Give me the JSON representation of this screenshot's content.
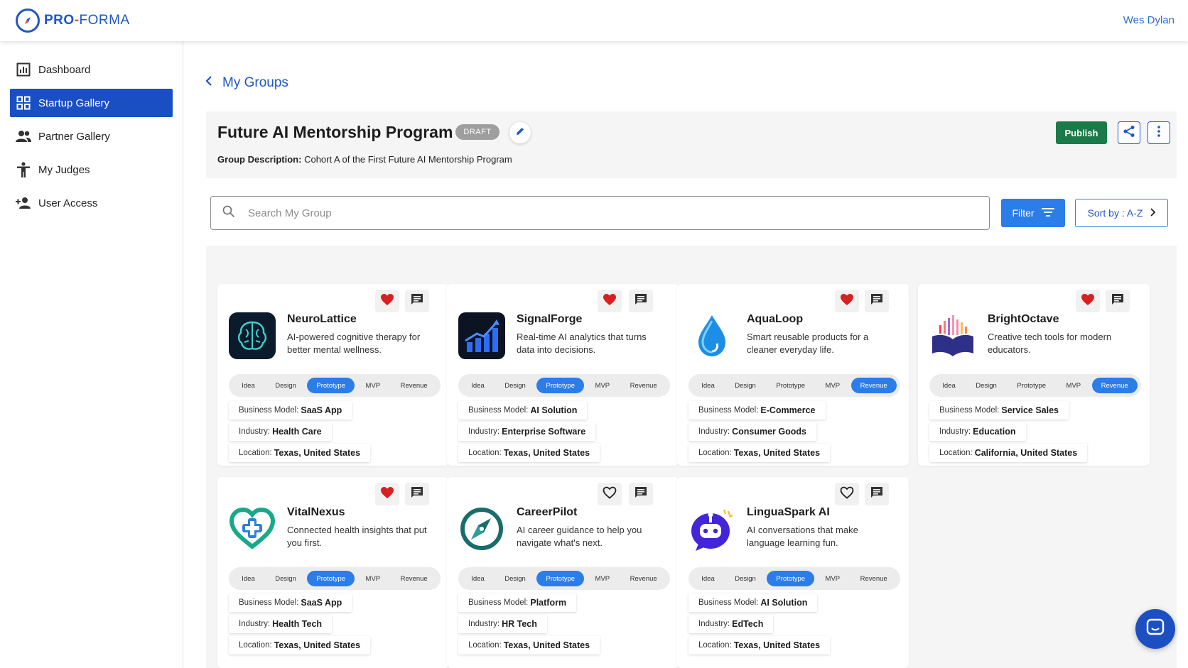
{
  "app": {
    "logo_text_left": "PRO",
    "logo_text_dash": "-",
    "logo_text_right": "FORMA",
    "user_name": "Wes Dylan",
    "brand_color": "#1f56c9"
  },
  "sidebar": {
    "items": [
      {
        "label": "Dashboard",
        "icon": "chart-icon"
      },
      {
        "label": "Startup Gallery",
        "icon": "grid-icon",
        "active": true
      },
      {
        "label": "Partner Gallery",
        "icon": "people-icon"
      },
      {
        "label": "My Judges",
        "icon": "person-icon"
      },
      {
        "label": "User Access",
        "icon": "add-user-icon"
      }
    ]
  },
  "breadcrumb": {
    "back_label": "My Groups"
  },
  "group": {
    "title": "Future AI Mentorship Program",
    "status": "DRAFT",
    "description_label": "Group Description:",
    "description": "Cohort A of the First Future AI Mentorship Program",
    "publish_label": "Publish"
  },
  "search": {
    "placeholder": "Search My Group",
    "value": ""
  },
  "filter_label": "Filter",
  "sort_label": "Sort by : A-Z",
  "labels": {
    "business_model": "Business Model:",
    "industry": "Industry:",
    "location": "Location:"
  },
  "stages": [
    "Idea",
    "Design",
    "Prototype",
    "MVP",
    "Revenue"
  ],
  "startups": [
    {
      "name": "NeuroLattice",
      "desc": "AI-powered cognitive therapy for better mental wellness.",
      "stage": "Prototype",
      "business_model": "SaaS App",
      "industry": "Health Care",
      "location": "Texas, United States",
      "favorited": true,
      "logo": "brain-logo-icon"
    },
    {
      "name": "SignalForge",
      "desc": "Real-time AI analytics that turns data into decisions.",
      "stage": "Prototype",
      "business_model": "AI Solution",
      "industry": "Enterprise Software",
      "location": "Texas, United States",
      "favorited": true,
      "logo": "growth-chart-logo-icon"
    },
    {
      "name": "AquaLoop",
      "desc": "Smart reusable products for a cleaner everyday life.",
      "stage": "Revenue",
      "business_model": "E-Commerce",
      "industry": "Consumer Goods",
      "location": "Texas, United States",
      "favorited": true,
      "logo": "water-drop-logo-icon"
    },
    {
      "name": "BrightOctave",
      "desc": "Creative tech tools for modern educators.",
      "stage": "Revenue",
      "business_model": "Service Sales",
      "industry": "Education",
      "location": "California, United States",
      "favorited": true,
      "logo": "open-book-logo-icon"
    },
    {
      "name": "VitalNexus",
      "desc": "Connected health insights that put you first.",
      "stage": "Prototype",
      "business_model": "SaaS App",
      "industry": "Health Tech",
      "location": "Texas, United States",
      "favorited": true,
      "logo": "heart-cross-logo-icon"
    },
    {
      "name": "CareerPilot",
      "desc": "AI career guidance to help you navigate what's next.",
      "stage": "Prototype",
      "business_model": "Platform",
      "industry": "HR Tech",
      "location": "Texas, United States",
      "favorited": false,
      "logo": "compass-logo-icon"
    },
    {
      "name": "LinguaSpark AI",
      "desc": "AI conversations that make language learning fun.",
      "stage": "Prototype",
      "business_model": "AI Solution",
      "industry": "EdTech",
      "location": "Texas, United States",
      "favorited": false,
      "logo": "robot-chat-logo-icon"
    }
  ]
}
